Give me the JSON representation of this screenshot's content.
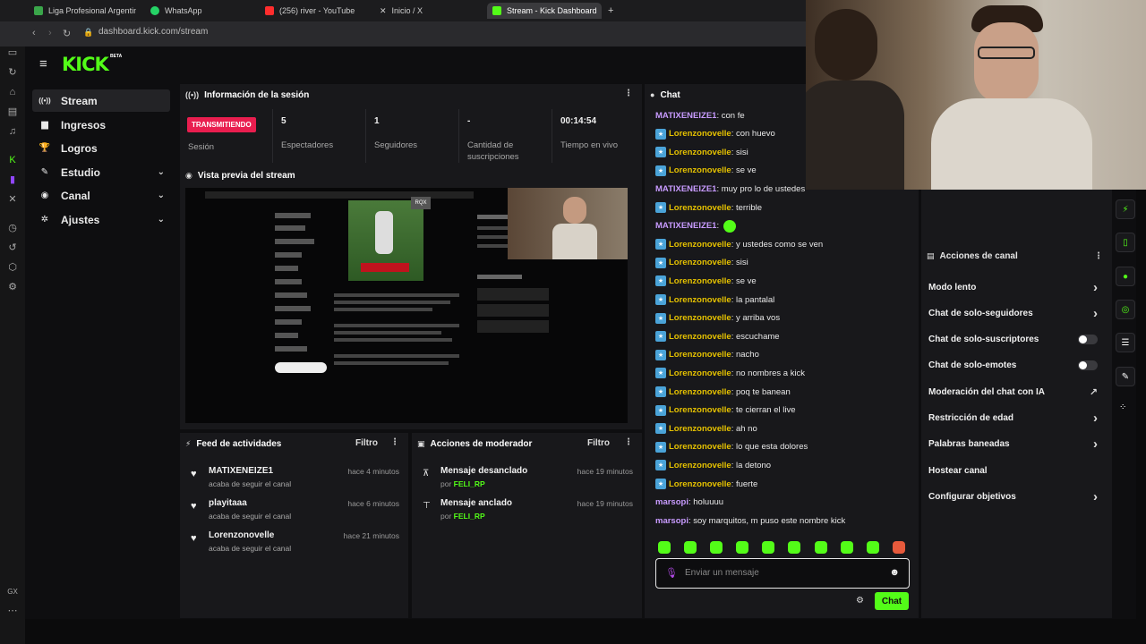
{
  "browser": {
    "tabs": [
      {
        "label": "Liga Profesional Argentina",
        "color": "#3aa64a"
      },
      {
        "label": "WhatsApp",
        "color": "#25d366"
      },
      {
        "label": "(256) river - YouTube",
        "color": "#ff2d2d"
      },
      {
        "label": "Inicio / X",
        "color": "#ffffff"
      },
      {
        "label": "Stream - Kick Dashboard",
        "color": "#53fc18"
      }
    ],
    "url": "dashboard.kick.com/stream"
  },
  "app": {
    "logo": "KICK",
    "beta": "BETA",
    "sidebar": [
      {
        "label": "Stream",
        "icon": "broadcast-icon",
        "glyph": "((•))",
        "active": true
      },
      {
        "label": "Ingresos",
        "icon": "money-icon",
        "glyph": "▆"
      },
      {
        "label": "Logros",
        "icon": "trophy-icon",
        "glyph": "🏆"
      },
      {
        "label": "Estudio",
        "icon": "studio-icon",
        "glyph": "✎",
        "chevron": "⌄"
      },
      {
        "label": "Canal",
        "icon": "channel-icon",
        "glyph": "◉",
        "chevron": "⌄"
      },
      {
        "label": "Ajustes",
        "icon": "gear-icon",
        "glyph": "✲",
        "chevron": "⌄"
      }
    ]
  },
  "session": {
    "title": "Información de la sesión",
    "stats": [
      {
        "value": "TRANSMITIENDO",
        "label": "Sesión"
      },
      {
        "value": "5",
        "label": "Espectadores"
      },
      {
        "value": "1",
        "label": "Seguidores"
      },
      {
        "value": "-",
        "label": "Cantidad de suscripciones"
      },
      {
        "value": "00:14:54",
        "label": "Tiempo en vivo"
      }
    ]
  },
  "preview": {
    "title": "Vista previa del stream",
    "badge": "RQX"
  },
  "activity": {
    "title": "Feed de actividades",
    "filter": "Filtro",
    "items": [
      {
        "name": "MATIXENEIZE1",
        "sub": "acaba de seguir el canal",
        "time": "hace 4 minutos"
      },
      {
        "name": "playitaaa",
        "sub": "acaba de seguir el canal",
        "time": "hace 6 minutos"
      },
      {
        "name": "Lorenzonovelle",
        "sub": "acaba de seguir el canal",
        "time": "hace 21 minutos"
      }
    ]
  },
  "moderator": {
    "title": "Acciones de moderador",
    "filter": "Filtro",
    "items": [
      {
        "name": "Mensaje desanclado",
        "by": "por",
        "who": "FELI_RP",
        "time": "hace 19 minutos",
        "icon": "unpin-icon"
      },
      {
        "name": "Mensaje anclado",
        "by": "por",
        "who": "FELI_RP",
        "time": "hace 19 minutos",
        "icon": "pin-icon"
      }
    ]
  },
  "chat": {
    "title": "Chat",
    "messages": [
      {
        "user": "MATIXENEIZE1",
        "text": "con fe",
        "badge": false,
        "cls": "u2"
      },
      {
        "user": "Lorenzonovelle",
        "text": "con huevo",
        "badge": true,
        "cls": "u1"
      },
      {
        "user": "Lorenzonovelle",
        "text": "sisi",
        "badge": true,
        "cls": "u1"
      },
      {
        "user": "Lorenzonovelle",
        "text": "se ve",
        "badge": true,
        "cls": "u1"
      },
      {
        "user": "MATIXENEIZE1",
        "text": "muy pro lo de ustedes",
        "badge": false,
        "cls": "u2"
      },
      {
        "user": "Lorenzonovelle",
        "text": "terrible",
        "badge": true,
        "cls": "u1"
      },
      {
        "user": "MATIXENEIZE1",
        "text": "",
        "badge": false,
        "cls": "u2",
        "emote": true
      },
      {
        "user": "Lorenzonovelle",
        "text": "y ustedes como se ven",
        "badge": true,
        "cls": "u1"
      },
      {
        "user": "Lorenzonovelle",
        "text": "sisi",
        "badge": true,
        "cls": "u1"
      },
      {
        "user": "Lorenzonovelle",
        "text": "se ve",
        "badge": true,
        "cls": "u1"
      },
      {
        "user": "Lorenzonovelle",
        "text": "la pantalal",
        "badge": true,
        "cls": "u1"
      },
      {
        "user": "Lorenzonovelle",
        "text": "y arriba vos",
        "badge": true,
        "cls": "u1"
      },
      {
        "user": "Lorenzonovelle",
        "text": "escuchame",
        "badge": true,
        "cls": "u1"
      },
      {
        "user": "Lorenzonovelle",
        "text": "nacho",
        "badge": true,
        "cls": "u1"
      },
      {
        "user": "Lorenzonovelle",
        "text": "no nombres a kick",
        "badge": true,
        "cls": "u1"
      },
      {
        "user": "Lorenzonovelle",
        "text": "poq te banean",
        "badge": true,
        "cls": "u1"
      },
      {
        "user": "Lorenzonovelle",
        "text": "te cierran el live",
        "badge": true,
        "cls": "u1"
      },
      {
        "user": "Lorenzonovelle",
        "text": "ah no",
        "badge": true,
        "cls": "u1"
      },
      {
        "user": "Lorenzonovelle",
        "text": "lo que esta dolores",
        "badge": true,
        "cls": "u1"
      },
      {
        "user": "Lorenzonovelle",
        "text": "la detono",
        "badge": true,
        "cls": "u1"
      },
      {
        "user": "Lorenzonovelle",
        "text": "fuerte",
        "badge": true,
        "cls": "u1"
      },
      {
        "user": "marsopi",
        "text": "holuuuu",
        "badge": false,
        "cls": "u3"
      },
      {
        "user": "marsopi",
        "text": "soy marquitos, m puso este nombre kick",
        "badge": false,
        "cls": "u3"
      }
    ],
    "placeholder": "Enviar un mensaje",
    "send": "Chat"
  },
  "channel_actions": {
    "title": "Acciones de canal",
    "items": [
      {
        "label": "Modo lento",
        "control": "chevron"
      },
      {
        "label": "Chat de solo-seguidores",
        "control": "chevron"
      },
      {
        "label": "Chat de solo-suscriptores",
        "control": "toggle",
        "on": false
      },
      {
        "label": "Chat de solo-emotes",
        "control": "toggle",
        "on": false
      },
      {
        "label": "Moderación del chat con IA",
        "control": "external"
      },
      {
        "label": "Restricción de edad",
        "control": "chevron"
      },
      {
        "label": "Palabras baneadas",
        "control": "chevron"
      },
      {
        "label": "Hostear canal",
        "control": "none"
      },
      {
        "label": "Configurar objetivos",
        "control": "chevron"
      }
    ]
  },
  "os_label": "GX"
}
